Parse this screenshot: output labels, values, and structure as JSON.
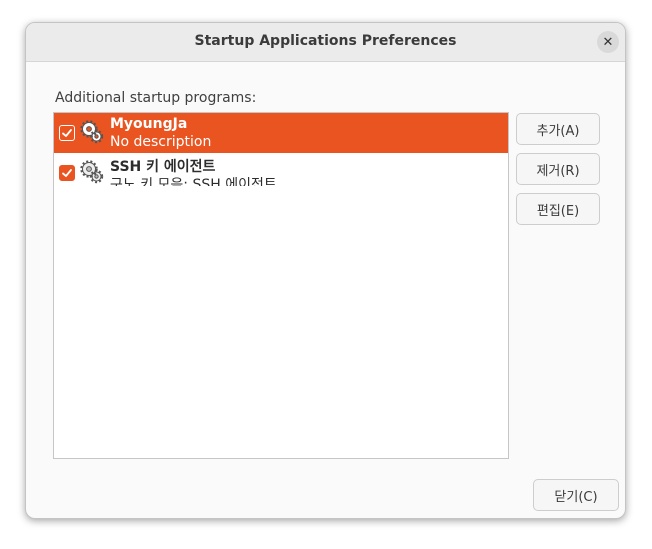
{
  "window": {
    "title": "Startup Applications Preferences",
    "close_glyph": "✕"
  },
  "list": {
    "heading": "Additional startup programs:",
    "items": [
      {
        "name": "MyoungJa",
        "description": "No description",
        "enabled": true,
        "selected": true,
        "icon": "gear-icon"
      },
      {
        "name": "SSH 키 에이전트",
        "description": "구노 키 모음: SSH 에이전트",
        "enabled": true,
        "selected": false,
        "icon": "gear-icon"
      }
    ]
  },
  "buttons": {
    "add": "추가(A)",
    "remove": "제거(R)",
    "edit": "편집(E)",
    "close": "닫기(C)"
  },
  "colors": {
    "accent": "#e95420"
  }
}
